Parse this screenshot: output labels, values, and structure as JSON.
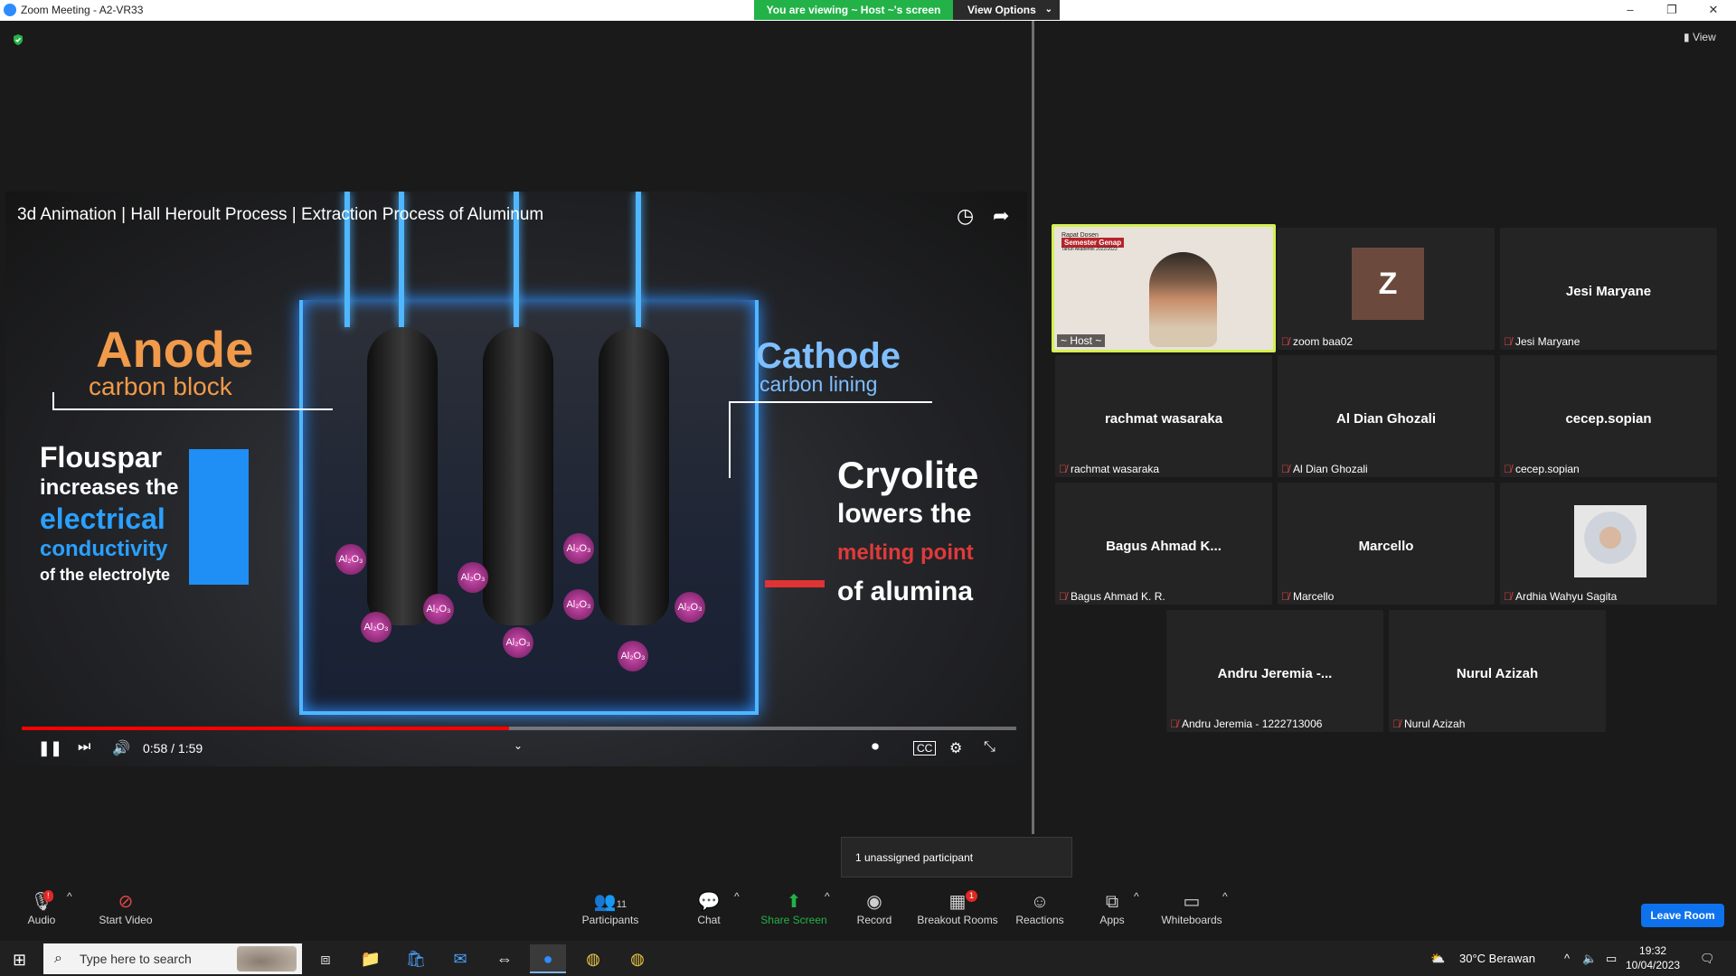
{
  "window": {
    "title": "Zoom Meeting - A2-VR33",
    "minimize": "–",
    "restore": "❐",
    "close": "✕"
  },
  "banner": {
    "viewing": "You are viewing ~ Host ~'s screen",
    "view_options": "View Options",
    "chev": "⌄"
  },
  "view_button": "▮ View",
  "video": {
    "title": "3d Animation | Hall Heroult Process | Extraction Process of Aluminum",
    "time": "0:58 / 1:59",
    "progress": 0.49,
    "labels": {
      "anode": "Anode",
      "anode_sub": "carbon block",
      "cathode": "Cathode",
      "cathode_sub": "carbon lining",
      "flou_1": "Flouspar",
      "flou_2": "increases the",
      "flou_3": "electrical",
      "flou_4": "conductivity",
      "flou_5": "of the electrolyte",
      "cryo_1": "Cryolite",
      "cryo_2": "lowers the",
      "cryo_3": "melting point",
      "cryo_4": "of alumina"
    },
    "ion_label": "Al₂O₃"
  },
  "participants": [
    {
      "name": "~ Host ~",
      "display": "",
      "video": true
    },
    {
      "name": "zoom baa02",
      "display": "",
      "avatar": "Z"
    },
    {
      "name": "Jesi Maryane",
      "display": "Jesi Maryane"
    },
    {
      "name": "rachmat wasaraka",
      "display": "rachmat wasaraka"
    },
    {
      "name": "Al Dian Ghozali",
      "display": "Al Dian Ghozali"
    },
    {
      "name": "cecep.sopian",
      "display": "cecep.sopian"
    },
    {
      "name": "Bagus Ahmad K. R.",
      "display": "Bagus Ahmad K..."
    },
    {
      "name": "Marcello",
      "display": "Marcello"
    },
    {
      "name": "Ardhia Wahyu Sagita",
      "display": ""
    },
    {
      "name": "Andru Jeremia - 1222713006",
      "display": "Andru Jeremia -..."
    },
    {
      "name": "Nurul Azizah",
      "display": "Nurul Azizah"
    }
  ],
  "host_slide": {
    "line1": "Rapat Dosen",
    "line2": "Semester Genap",
    "line3": "Tahun Akademik 2022/2023"
  },
  "toast": "1 unassigned participant",
  "toolbar": {
    "audio": "Audio",
    "start_video": "Start Video",
    "participants": "Participants",
    "participants_count": "11",
    "chat": "Chat",
    "share_screen": "Share Screen",
    "record": "Record",
    "breakout_rooms": "Breakout Rooms",
    "breakout_badge": "1",
    "reactions": "Reactions",
    "apps": "Apps",
    "whiteboards": "Whiteboards",
    "leave": "Leave Room",
    "audio_badge": "!"
  },
  "taskbar": {
    "search_placeholder": "Type here to search",
    "weather": "30°C  Berawan",
    "time": "19:32",
    "date": "10/04/2023"
  },
  "colors": {
    "accent": "#0e72ed",
    "green": "#23b248",
    "host_border": "#d4f04f",
    "muted_red": "#e04646"
  }
}
